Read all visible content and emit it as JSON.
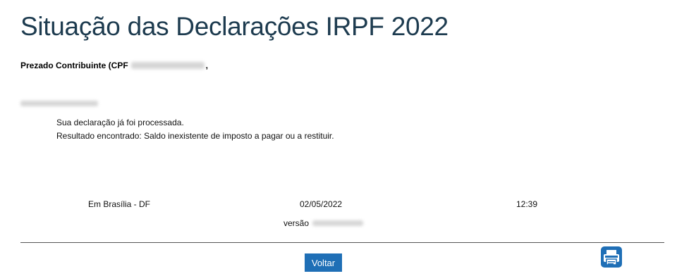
{
  "page": {
    "title": "Situação das Declarações IRPF 2022",
    "greeting_prefix": "Prezado Contribuinte (CPF",
    "greeting_suffix": ","
  },
  "message": {
    "line1": "Sua declaração já foi processada.",
    "line2": "Resultado encontrado: Saldo inexistente de imposto a pagar ou a restituir."
  },
  "footer": {
    "place": "Em Brasília - DF",
    "date": "02/05/2022",
    "time": "12:39",
    "version_label": "versão"
  },
  "actions": {
    "back_label": "Voltar",
    "print_icon": "printer-icon"
  },
  "colors": {
    "title": "#1d3b4f",
    "button": "#1f6fb6",
    "icon": "#1f6fb6"
  }
}
